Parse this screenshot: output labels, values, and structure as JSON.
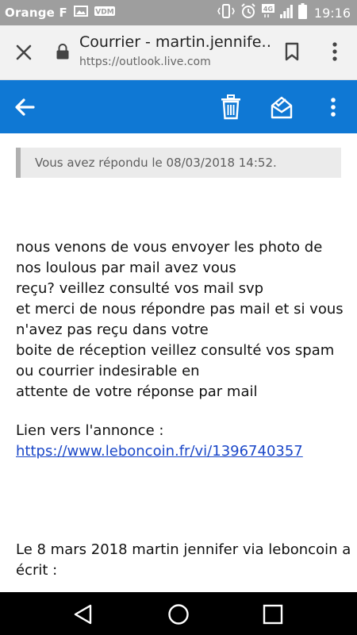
{
  "status_bar": {
    "carrier": "Orange F",
    "time": "19:16",
    "icons": [
      "image-icon",
      "vdm-icon",
      "vibrate-icon",
      "alarm-icon",
      "4g-icon",
      "signal-icon",
      "battery-icon"
    ],
    "vdm_label": "VDM"
  },
  "browser": {
    "title": "Courrier - martin.jennife…",
    "url": "https://outlook.live.com",
    "icons": [
      "close-icon",
      "lock-icon",
      "bookmark-icon",
      "more-vert-icon"
    ]
  },
  "app_bar": {
    "color": "#0f78d4",
    "icons": [
      "back-arrow-icon",
      "delete-icon",
      "mark-read-icon",
      "more-vert-icon"
    ]
  },
  "message": {
    "replied_banner": "Vous avez répondu le 08/03/2018 14:52.",
    "body_lines": [
      "nous venons de vous envoyer les photo de",
      "nos loulous par mail avez vous",
      "reçu? veillez consulté vos mail svp",
      "et merci de nous répondre pas mail et si vous",
      "n'avez pas reçu dans votre",
      "boite de réception veillez consulté vos spam",
      "ou courrier indesirable en",
      "attente de votre réponse par mail"
    ],
    "link_label": "Lien vers l'annonce :",
    "link_url": "https://www.leboncoin.fr/vi/1396740357",
    "quote_header_1": "Le 8 mars 2018 martin jennifer via leboncoin a",
    "quote_header_2": "écrit :"
  },
  "nav_bar": {
    "icons": [
      "back-triangle-icon",
      "home-circle-icon",
      "recents-square-icon"
    ]
  }
}
